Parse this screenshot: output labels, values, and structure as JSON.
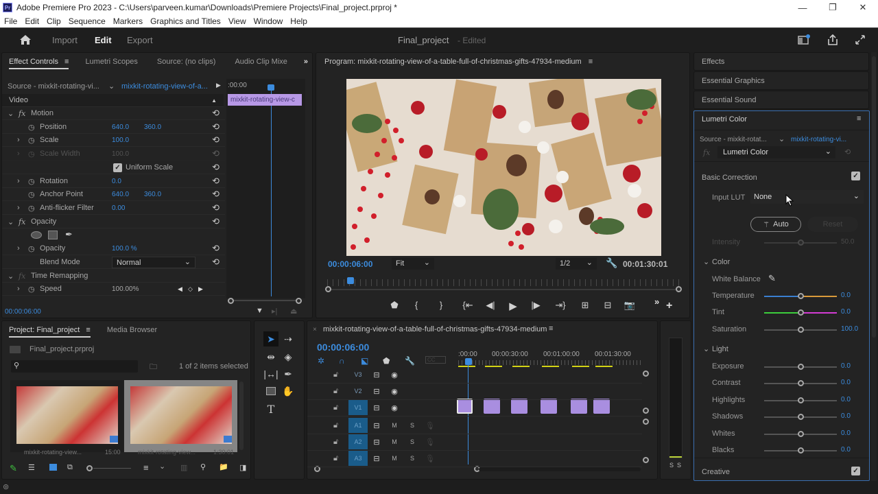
{
  "window": {
    "title": "Adobe Premiere Pro 2023 - C:\\Users\\parveen.kumar\\Downloads\\Premiere Projects\\Final_project.prproj *",
    "app_icon": "Pr",
    "minimize": "—",
    "maximize": "❐",
    "close": "✕"
  },
  "menu": [
    "File",
    "Edit",
    "Clip",
    "Sequence",
    "Markers",
    "Graphics and Titles",
    "View",
    "Window",
    "Help"
  ],
  "header": {
    "home_icon": "home-icon",
    "nav": [
      "Import",
      "Edit",
      "Export"
    ],
    "active_nav": "Edit",
    "project_name": "Final_project",
    "status": "- Edited"
  },
  "effect_controls": {
    "tabs": [
      "Effect Controls",
      "Lumetri Scopes",
      "Source: (no clips)",
      "Audio Clip Mixe"
    ],
    "more": "»",
    "source_label": "Source - mixkit-rotating-vi...",
    "clip_label": "mixkit-rotating-view-of-a...",
    "mini_time": ":00:00",
    "mini_clip": "mixkit-rotating-view-c",
    "video_header": "Video",
    "motion": "Motion",
    "position": {
      "label": "Position",
      "x": "640.0",
      "y": "360.0"
    },
    "scale": {
      "label": "Scale",
      "value": "100.0"
    },
    "scale_width": {
      "label": "Scale Width",
      "value": "100.0"
    },
    "uniform_scale": "Uniform Scale",
    "rotation": {
      "label": "Rotation",
      "value": "0.0"
    },
    "anchor_point": {
      "label": "Anchor Point",
      "x": "640.0",
      "y": "360.0"
    },
    "anti_flicker": {
      "label": "Anti-flicker Filter",
      "value": "0.00"
    },
    "opacity_section": "Opacity",
    "opacity": {
      "label": "Opacity",
      "value": "100.0 %"
    },
    "blend_mode": {
      "label": "Blend Mode",
      "value": "Normal"
    },
    "time_remapping": "Time Remapping",
    "speed": {
      "label": "Speed",
      "value": "100.00%"
    },
    "timecode": "00:00:06:00"
  },
  "program": {
    "title": "Program: mixkit-rotating-view-of-a-table-full-of-christmas-gifts-47934-medium",
    "timecode": "00:00:06:00",
    "fit": "Fit",
    "resolution": "1/2",
    "duration": "00:01:30:01",
    "playhead_fraction": 0.067
  },
  "project": {
    "tabs": [
      "Project: Final_project",
      "Media Browser"
    ],
    "file": "Final_project.prproj",
    "search_placeholder": "",
    "selection": "1 of 2 items selected",
    "items": [
      {
        "name": "mixkit-rotating-view...",
        "duration": "15:00",
        "selected": false
      },
      {
        "name": "mixkit-rotating-view...",
        "duration": "1:30:01",
        "selected": true
      }
    ]
  },
  "timeline": {
    "title": "mixkit-rotating-view-of-a-table-full-of-christmas-gifts-47934-medium",
    "timecode": "00:00:06:00",
    "ruler": [
      ":00:00",
      "00:00:30:00",
      "00:01:00:00",
      "00:01:30:00"
    ],
    "video_tracks": [
      "V3",
      "V2",
      "V1"
    ],
    "audio_tracks": [
      "A1",
      "A2",
      "A3"
    ],
    "mute": "M",
    "solo": "S",
    "meter_labels": [
      "S",
      "S"
    ]
  },
  "right_panels": {
    "collapsed": [
      "Effects",
      "Essential Graphics",
      "Essential Sound"
    ],
    "lumetri": {
      "title": "Lumetri Color",
      "source": "Source - mixkit-rotat...",
      "clip": "mixkit-rotating-vi...",
      "effect": "Lumetri Color",
      "basic_correction": "Basic Correction",
      "input_lut_label": "Input LUT",
      "input_lut_value": "None",
      "auto": "Auto",
      "reset": "Reset",
      "intensity": {
        "label": "Intensity",
        "value": "50.0"
      },
      "color_section": "Color",
      "white_balance": "White Balance",
      "temperature": {
        "label": "Temperature",
        "value": "0.0"
      },
      "tint": {
        "label": "Tint",
        "value": "0.0"
      },
      "saturation": {
        "label": "Saturation",
        "value": "100.0"
      },
      "light_section": "Light",
      "light": [
        {
          "label": "Exposure",
          "value": "0.0"
        },
        {
          "label": "Contrast",
          "value": "0.0"
        },
        {
          "label": "Highlights",
          "value": "0.0"
        },
        {
          "label": "Shadows",
          "value": "0.0"
        },
        {
          "label": "Whites",
          "value": "0.0"
        },
        {
          "label": "Blacks",
          "value": "0.0"
        }
      ],
      "creative": "Creative"
    }
  },
  "colors": {
    "accent_blue": "#3c8cde",
    "clip_purple": "#a98ee0",
    "track_blue": "#1a5c8a"
  }
}
